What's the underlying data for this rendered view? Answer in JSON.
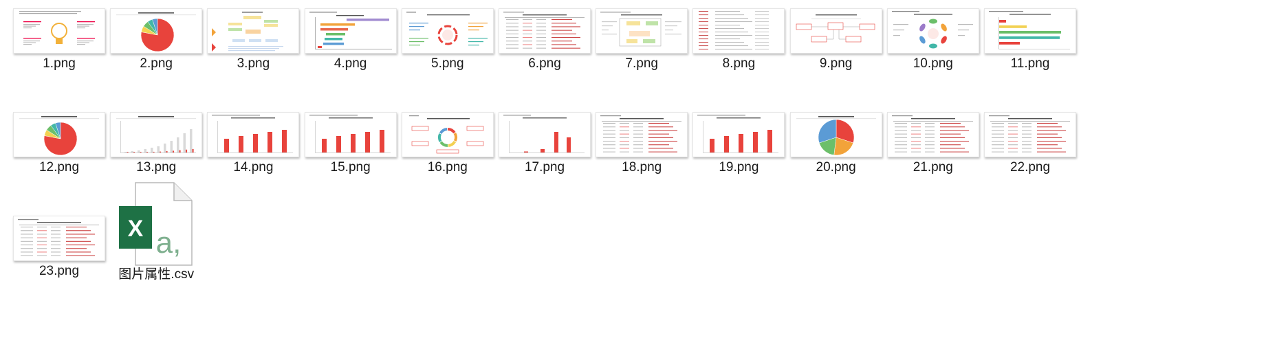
{
  "window": {
    "title": ""
  },
  "files": [
    {
      "name": "1.png",
      "kind": "bulb"
    },
    {
      "name": "2.png",
      "kind": "pie"
    },
    {
      "name": "3.png",
      "kind": "mindmap"
    },
    {
      "name": "4.png",
      "kind": "gantt"
    },
    {
      "name": "5.png",
      "kind": "radial"
    },
    {
      "name": "6.png",
      "kind": "table"
    },
    {
      "name": "7.png",
      "kind": "flow"
    },
    {
      "name": "8.png",
      "kind": "textcols"
    },
    {
      "name": "9.png",
      "kind": "boxes"
    },
    {
      "name": "10.png",
      "kind": "petals"
    },
    {
      "name": "11.png",
      "kind": "hbars"
    },
    {
      "name": "12.png",
      "kind": "pie"
    },
    {
      "name": "13.png",
      "kind": "growbars"
    },
    {
      "name": "14.png",
      "kind": "redbars"
    },
    {
      "name": "15.png",
      "kind": "redbars"
    },
    {
      "name": "16.png",
      "kind": "donut"
    },
    {
      "name": "17.png",
      "kind": "sparsebars"
    },
    {
      "name": "18.png",
      "kind": "table"
    },
    {
      "name": "19.png",
      "kind": "redbars"
    },
    {
      "name": "20.png",
      "kind": "pie4"
    },
    {
      "name": "21.png",
      "kind": "table"
    },
    {
      "name": "22.png",
      "kind": "table"
    },
    {
      "name": "23.png",
      "kind": "table"
    },
    {
      "name": "图片属性.csv",
      "kind": "csv"
    }
  ],
  "csv_icon": {
    "letter": "X",
    "glyph": "a,",
    "colors": {
      "excel_green": "#1e7145",
      "sheet_green": "#4a9a6b",
      "page": "#ffffff",
      "page_border": "#b8b8b8",
      "glyph": "#7fb08f"
    }
  },
  "colors": {
    "red": "#e8433c",
    "orange": "#f2a33a",
    "yellow": "#f3d152",
    "green": "#6cbf6a",
    "teal": "#42b7a8",
    "blue": "#5b9bd5",
    "purple": "#9b7bc9",
    "text_gray": "#9a9a9a"
  }
}
